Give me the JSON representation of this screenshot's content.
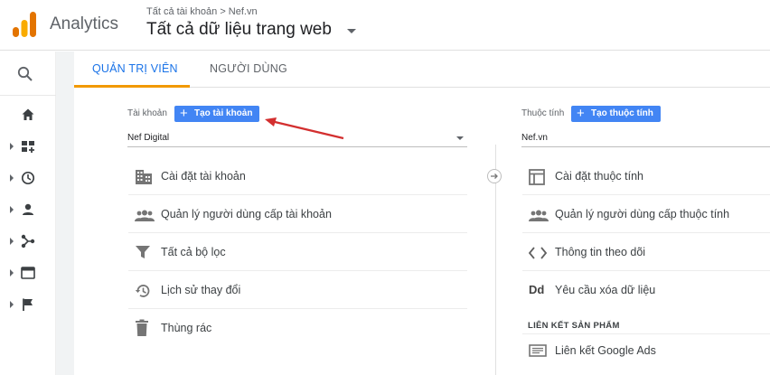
{
  "header": {
    "app_name": "Analytics",
    "breadcrumb": "Tất cả tài khoản > Nef.vn",
    "view_title": "Tất cả dữ liệu trang web"
  },
  "tabs": [
    {
      "label": "QUẢN TRỊ VIÊN",
      "active": true
    },
    {
      "label": "NGƯỜI DÙNG",
      "active": false
    }
  ],
  "account": {
    "label": "Tài khoản",
    "create_button": "Tạo tài khoản",
    "selected": "Nef Digital",
    "items": [
      {
        "icon": "building-icon",
        "label": "Cài đặt tài khoản"
      },
      {
        "icon": "people-icon",
        "label": "Quản lý người dùng cấp tài khoản"
      },
      {
        "icon": "filter-icon",
        "label": "Tất cả bộ lọc"
      },
      {
        "icon": "history-icon",
        "label": "Lịch sử thay đổi"
      },
      {
        "icon": "trash-icon",
        "label": "Thùng rác"
      }
    ]
  },
  "property": {
    "label": "Thuộc tính",
    "create_button": "Tạo thuộc tính",
    "selected": "Nef.vn",
    "items": [
      {
        "icon": "layout-icon",
        "label": "Cài đặt thuộc tính"
      },
      {
        "icon": "people-icon",
        "label": "Quản lý người dùng cấp thuộc tính"
      },
      {
        "icon": "code-icon",
        "label": "Thông tin theo dõi"
      },
      {
        "icon": "dd-icon",
        "label": "Yêu cầu xóa dữ liệu"
      }
    ],
    "section_heading": "LIÊN KẾT SẢN PHẨM",
    "linked_items": [
      {
        "icon": "ads-icon",
        "label": "Liên kết Google Ads"
      }
    ]
  },
  "plus_symbol": "+",
  "dd_glyph": "Dd",
  "colors": {
    "accent_blue": "#1a73e8",
    "button_blue": "#4285f4",
    "tab_underline": "#f29900",
    "annotation_red": "#d32f2f"
  }
}
